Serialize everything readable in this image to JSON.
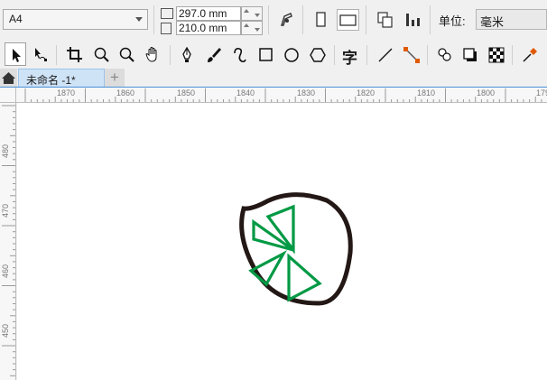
{
  "property_bar": {
    "page_size": "A4",
    "width_value": "297.0 mm",
    "height_value": "210.0 mm",
    "unit_label": "单位:",
    "unit_value": "毫米"
  },
  "tabs": {
    "document_title": "未命名 -1*",
    "add_tab_label": "+"
  },
  "rulers": {
    "horizontal": [
      "1870",
      "1860",
      "1850",
      "1840",
      "1830",
      "1820",
      "1810",
      "1800",
      "179"
    ],
    "vertical": [
      "480",
      "470",
      "460",
      "450"
    ]
  },
  "tools": [
    {
      "name": "pick-tool",
      "icon": "arrow-pointer-icon"
    },
    {
      "name": "shape-tool",
      "icon": "node-edit-icon"
    },
    {
      "name": "crop-tool",
      "icon": "crop-icon"
    },
    {
      "name": "zoom-tool",
      "icon": "magnifier-icon"
    },
    {
      "name": "zoom-out-tool",
      "icon": "magnifier-icon"
    },
    {
      "name": "pan-tool",
      "icon": "hand-icon"
    },
    {
      "name": "pen-tool",
      "icon": "pen-nib-icon"
    },
    {
      "name": "artistic-media-tool",
      "icon": "brush-icon"
    },
    {
      "name": "bezier-tool",
      "icon": "curve-icon"
    },
    {
      "name": "rectangle-tool",
      "icon": "rectangle-icon"
    },
    {
      "name": "ellipse-tool",
      "icon": "ellipse-icon"
    },
    {
      "name": "polygon-tool",
      "icon": "polygon-icon"
    },
    {
      "name": "text-tool",
      "icon": "text-icon",
      "glyph": "字"
    },
    {
      "name": "dimension-tool",
      "icon": "line-icon"
    },
    {
      "name": "connector-tool",
      "icon": "connector-icon"
    },
    {
      "name": "blend-tool",
      "icon": "blend-icon"
    },
    {
      "name": "drop-shadow-tool",
      "icon": "shadow-icon"
    },
    {
      "name": "transparency-tool",
      "icon": "checkerboard-icon"
    },
    {
      "name": "eyedropper-tool",
      "icon": "eyedropper-icon"
    }
  ],
  "colors": {
    "accent_blue": "#4a90d9",
    "tab_active": "#cfe3f7",
    "shape_outline": "#231815",
    "shape_green": "#009944"
  }
}
